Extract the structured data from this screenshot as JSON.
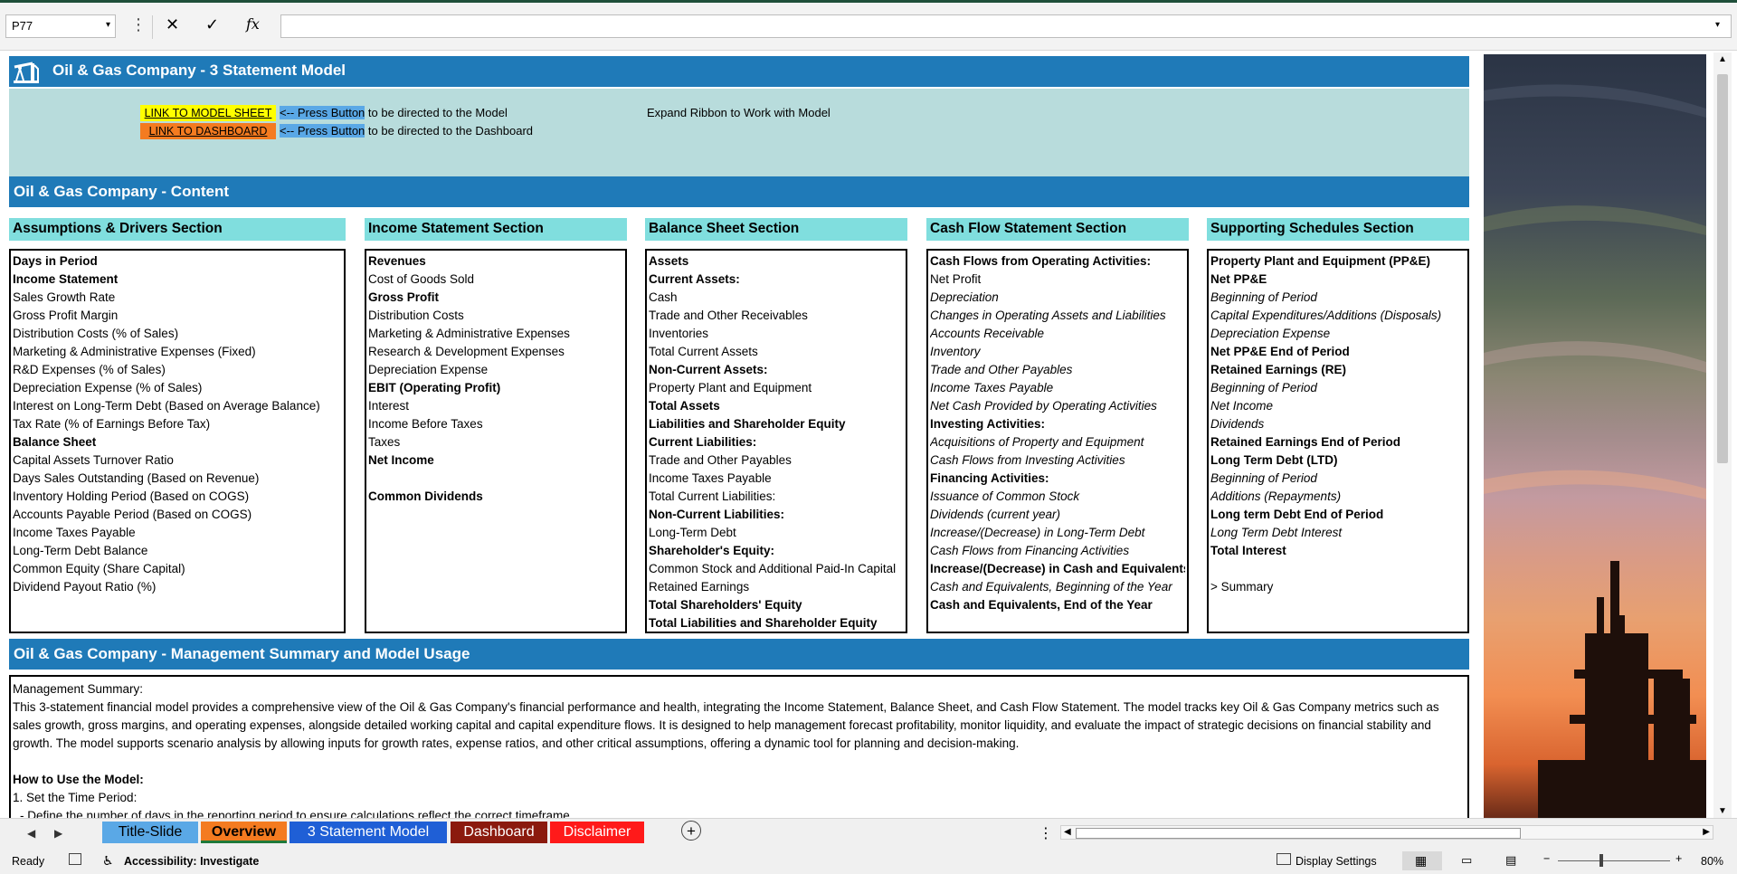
{
  "formula_bar": {
    "name_box": "P77",
    "formula": "",
    "more_glyph": "⋮",
    "cancel_glyph": "✕",
    "enter_glyph": "✓",
    "fx_glyph": "fx"
  },
  "title_banner": {
    "title": "Oil & Gas Company - 3 Statement Model"
  },
  "links": {
    "model_link": "LINK TO MODEL SHEET",
    "dashboard_link": "LINK TO DASHBOARD",
    "press_hint": "<-- Press Button",
    "model_hint_rest": " to be directed to the Model",
    "dashboard_hint_rest": " to be directed to the Dashboard",
    "expand_note": "Expand Ribbon to Work with Model"
  },
  "content_banner": {
    "title": "Oil & Gas Company - Content"
  },
  "sections": [
    {
      "title": "Assumptions & Drivers Section",
      "items": [
        {
          "text": "Days in Period",
          "style": "b"
        },
        {
          "text": "Income Statement",
          "style": "b"
        },
        {
          "text": "Sales Growth Rate",
          "style": ""
        },
        {
          "text": "Gross Profit Margin",
          "style": ""
        },
        {
          "text": "Distribution Costs (% of Sales)",
          "style": ""
        },
        {
          "text": "Marketing & Administrative Expenses (Fixed)",
          "style": ""
        },
        {
          "text": "R&D Expenses (% of Sales)",
          "style": ""
        },
        {
          "text": "Depreciation Expense (% of Sales)",
          "style": ""
        },
        {
          "text": "Interest on Long-Term Debt (Based on Average Balance)",
          "style": ""
        },
        {
          "text": "Tax Rate (% of Earnings Before Tax)",
          "style": ""
        },
        {
          "text": "Balance Sheet",
          "style": "b"
        },
        {
          "text": "Capital Assets Turnover Ratio",
          "style": ""
        },
        {
          "text": "Days Sales Outstanding (Based on Revenue)",
          "style": ""
        },
        {
          "text": "Inventory Holding Period (Based on COGS)",
          "style": ""
        },
        {
          "text": "Accounts Payable Period (Based on COGS)",
          "style": ""
        },
        {
          "text": "Income Taxes Payable",
          "style": ""
        },
        {
          "text": "Long-Term Debt Balance",
          "style": ""
        },
        {
          "text": "Common Equity (Share Capital)",
          "style": ""
        },
        {
          "text": "Dividend Payout Ratio (%)",
          "style": ""
        }
      ]
    },
    {
      "title": "Income Statement Section",
      "items": [
        {
          "text": "Revenues",
          "style": "b"
        },
        {
          "text": "Cost of Goods Sold",
          "style": ""
        },
        {
          "text": "Gross Profit",
          "style": "b"
        },
        {
          "text": "Distribution Costs",
          "style": ""
        },
        {
          "text": "Marketing & Administrative Expenses",
          "style": ""
        },
        {
          "text": "Research & Development Expenses",
          "style": ""
        },
        {
          "text": "Depreciation Expense",
          "style": ""
        },
        {
          "text": "EBIT (Operating Profit)",
          "style": "b"
        },
        {
          "text": "Interest",
          "style": ""
        },
        {
          "text": "Income Before Taxes",
          "style": ""
        },
        {
          "text": "Taxes",
          "style": ""
        },
        {
          "text": "Net Income",
          "style": "b"
        },
        {
          "text": "",
          "style": ""
        },
        {
          "text": "Common Dividends",
          "style": "b"
        }
      ]
    },
    {
      "title": "Balance Sheet Section",
      "items": [
        {
          "text": "Assets",
          "style": "b"
        },
        {
          "text": "Current Assets:",
          "style": "b"
        },
        {
          "text": "Cash",
          "style": ""
        },
        {
          "text": "Trade and Other Receivables",
          "style": ""
        },
        {
          "text": "Inventories",
          "style": ""
        },
        {
          "text": "Total Current Assets",
          "style": ""
        },
        {
          "text": "Non-Current Assets:",
          "style": "b"
        },
        {
          "text": "Property Plant and Equipment",
          "style": ""
        },
        {
          "text": "Total Assets",
          "style": "b"
        },
        {
          "text": "Liabilities and Shareholder Equity",
          "style": "b"
        },
        {
          "text": "Current Liabilities:",
          "style": "b"
        },
        {
          "text": "Trade and Other Payables",
          "style": ""
        },
        {
          "text": "Income Taxes Payable",
          "style": ""
        },
        {
          "text": "Total Current Liabilities:",
          "style": ""
        },
        {
          "text": "Non-Current Liabilities:",
          "style": "b"
        },
        {
          "text": "Long-Term Debt",
          "style": ""
        },
        {
          "text": "Shareholder's Equity:",
          "style": "b"
        },
        {
          "text": "Common Stock and Additional Paid-In Capital",
          "style": ""
        },
        {
          "text": "Retained Earnings",
          "style": ""
        },
        {
          "text": "Total Shareholders' Equity",
          "style": "b"
        },
        {
          "text": "Total Liabilities and Shareholder Equity",
          "style": "b"
        }
      ]
    },
    {
      "title": "Cash Flow Statement Section",
      "items": [
        {
          "text": "Cash Flows from Operating Activities:",
          "style": "b"
        },
        {
          "text": "Net Profit",
          "style": ""
        },
        {
          "text": "Depreciation",
          "style": "i"
        },
        {
          "text": "Changes in Operating Assets and Liabilities",
          "style": "i"
        },
        {
          "text": "Accounts Receivable",
          "style": "i"
        },
        {
          "text": "Inventory",
          "style": "i"
        },
        {
          "text": "Trade and Other Payables",
          "style": "i"
        },
        {
          "text": "Income Taxes Payable",
          "style": "i"
        },
        {
          "text": "Net Cash Provided by Operating Activities",
          "style": "i"
        },
        {
          "text": "Investing Activities:",
          "style": "b"
        },
        {
          "text": "Acquisitions of Property and Equipment",
          "style": "i"
        },
        {
          "text": "Cash Flows from Investing Activities",
          "style": "i"
        },
        {
          "text": "Financing Activities:",
          "style": "b"
        },
        {
          "text": "Issuance of Common Stock",
          "style": "i"
        },
        {
          "text": "Dividends (current year)",
          "style": "i"
        },
        {
          "text": "Increase/(Decrease) in Long-Term Debt",
          "style": "i"
        },
        {
          "text": "Cash Flows from Financing Activities",
          "style": "i"
        },
        {
          "text": "Increase/(Decrease) in Cash and Equivalents",
          "style": "b"
        },
        {
          "text": "Cash and Equivalents, Beginning of the Year",
          "style": "i"
        },
        {
          "text": "Cash and Equivalents, End of the Year",
          "style": "b"
        }
      ]
    },
    {
      "title": "Supporting Schedules Section",
      "items": [
        {
          "text": "Property Plant and Equipment (PP&E)",
          "style": "b"
        },
        {
          "text": "Net PP&E",
          "style": "b"
        },
        {
          "text": "Beginning of Period",
          "style": "i"
        },
        {
          "text": "Capital Expenditures/Additions (Disposals)",
          "style": "i"
        },
        {
          "text": "Depreciation Expense",
          "style": "i"
        },
        {
          "text": "Net PP&E End of Period",
          "style": "b"
        },
        {
          "text": "Retained Earnings (RE)",
          "style": "b"
        },
        {
          "text": "Beginning of Period",
          "style": "i"
        },
        {
          "text": "Net Income",
          "style": "i"
        },
        {
          "text": "Dividends",
          "style": "i"
        },
        {
          "text": "Retained Earnings End of Period",
          "style": "b"
        },
        {
          "text": "Long Term Debt (LTD)",
          "style": "b"
        },
        {
          "text": "Beginning of Period",
          "style": "i"
        },
        {
          "text": "Additions (Repayments)",
          "style": "i"
        },
        {
          "text": "Long term Debt End of Period",
          "style": "b"
        },
        {
          "text": "Long Term Debt Interest",
          "style": "i"
        },
        {
          "text": "Total Interest",
          "style": "b"
        },
        {
          "text": "",
          "style": ""
        },
        {
          "text": "> Summary",
          "style": ""
        }
      ]
    }
  ],
  "management_banner": {
    "title": "Oil & Gas Company - Management Summary and Model Usage"
  },
  "summary": {
    "heading": "Management Summary:",
    "body": "This 3-statement financial model provides a comprehensive view of the Oil & Gas Company's financial performance and health, integrating the Income Statement, Balance Sheet, and Cash Flow Statement. The model tracks key Oil & Gas Company metrics such as sales growth, gross margins, and operating expenses, alongside detailed working capital and capital expenditure flows. It is designed to help management forecast profitability, monitor liquidity, and evaluate the impact of strategic decisions on financial stability and growth. The model supports scenario analysis by allowing inputs for growth rates, expense ratios, and other critical assumptions, offering a dynamic tool for planning and decision-making.",
    "howto_heading": "How to Use the Model:",
    "step1": "1. Set the Time Period:",
    "step1_detail": "- Define the number of days in the reporting period to ensure calculations reflect the correct timeframe."
  },
  "tabs": [
    {
      "label": "Title-Slide",
      "bg": "#5aa8e6",
      "color": "#000000",
      "bold": false,
      "active": false
    },
    {
      "label": "Overview",
      "bg": "#f47b20",
      "color": "#000000",
      "bold": true,
      "active": true
    },
    {
      "label": "3 Statement Model",
      "bg": "#1f5fd6",
      "color": "#ffffff",
      "bold": false,
      "active": false
    },
    {
      "label": "Dashboard",
      "bg": "#8b1a0e",
      "color": "#ffffff",
      "bold": false,
      "active": false
    },
    {
      "label": "Disclaimer",
      "bg": "#ff1a1a",
      "color": "#ffffff",
      "bold": false,
      "active": false
    }
  ],
  "status_bar": {
    "ready": "Ready",
    "accessibility": "Accessibility: Investigate",
    "display_settings": "Display Settings",
    "zoom": "80%"
  },
  "colors": {
    "banner": "#1f7ab8",
    "section_header": "#80dede",
    "link_panel": "#b8dcdc"
  }
}
